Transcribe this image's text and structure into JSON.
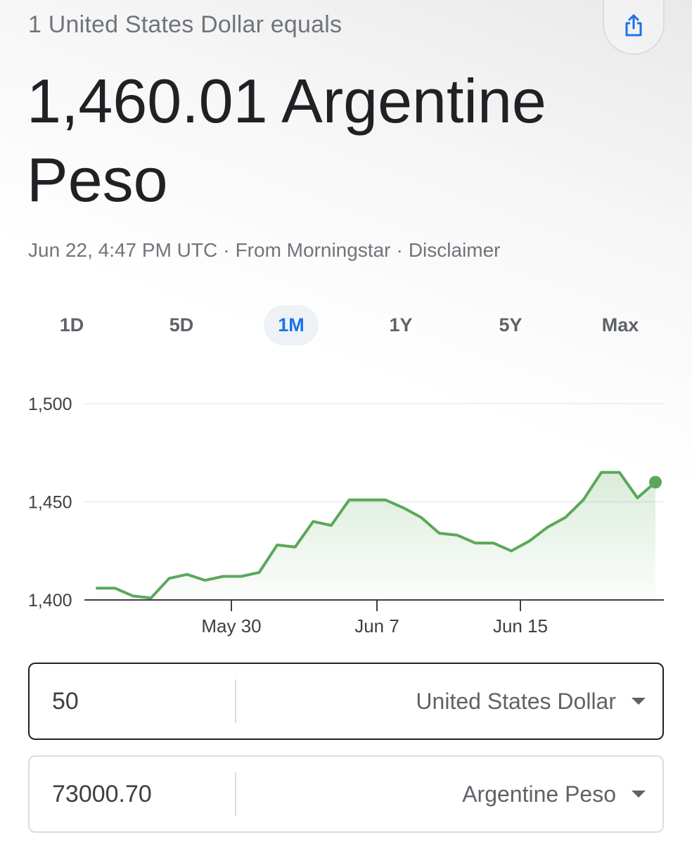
{
  "header": {
    "equals_label": "1 United States Dollar equals",
    "value": "1,460.01 Argentine Peso",
    "share_icon": "share-icon"
  },
  "meta": {
    "timestamp": "Jun 22, 4:47 PM UTC",
    "separator": "·",
    "source": "From Morningstar",
    "disclaimer": "Disclaimer"
  },
  "range_tabs": [
    {
      "label": "1D",
      "active": false
    },
    {
      "label": "5D",
      "active": false
    },
    {
      "label": "1M",
      "active": true
    },
    {
      "label": "1Y",
      "active": false
    },
    {
      "label": "5Y",
      "active": false
    },
    {
      "label": "Max",
      "active": false
    }
  ],
  "colors": {
    "line": "#5ba85b",
    "active_tab": "#1a73e8"
  },
  "chart_data": {
    "type": "area",
    "x_ticks": [
      "May 30",
      "Jun 7",
      "Jun 15"
    ],
    "y_ticks": [
      "1,500",
      "1,450",
      "1,400"
    ],
    "y_tick_values": [
      1500,
      1450,
      1400
    ],
    "ylim": [
      1400,
      1500
    ],
    "grid": true,
    "values": [
      1406,
      1406,
      1402,
      1401,
      1411,
      1413,
      1410,
      1412,
      1412,
      1414,
      1428,
      1427,
      1440,
      1438,
      1451,
      1451,
      1451,
      1447,
      1442,
      1434,
      1433,
      1429,
      1429,
      1425,
      1430,
      1437,
      1442,
      1451,
      1465,
      1465,
      1452,
      1460
    ],
    "last_point_marker": true
  },
  "converter": {
    "from": {
      "amount": "50",
      "currency": "United States Dollar"
    },
    "to": {
      "amount": "73000.70",
      "currency": "Argentine Peso"
    }
  }
}
